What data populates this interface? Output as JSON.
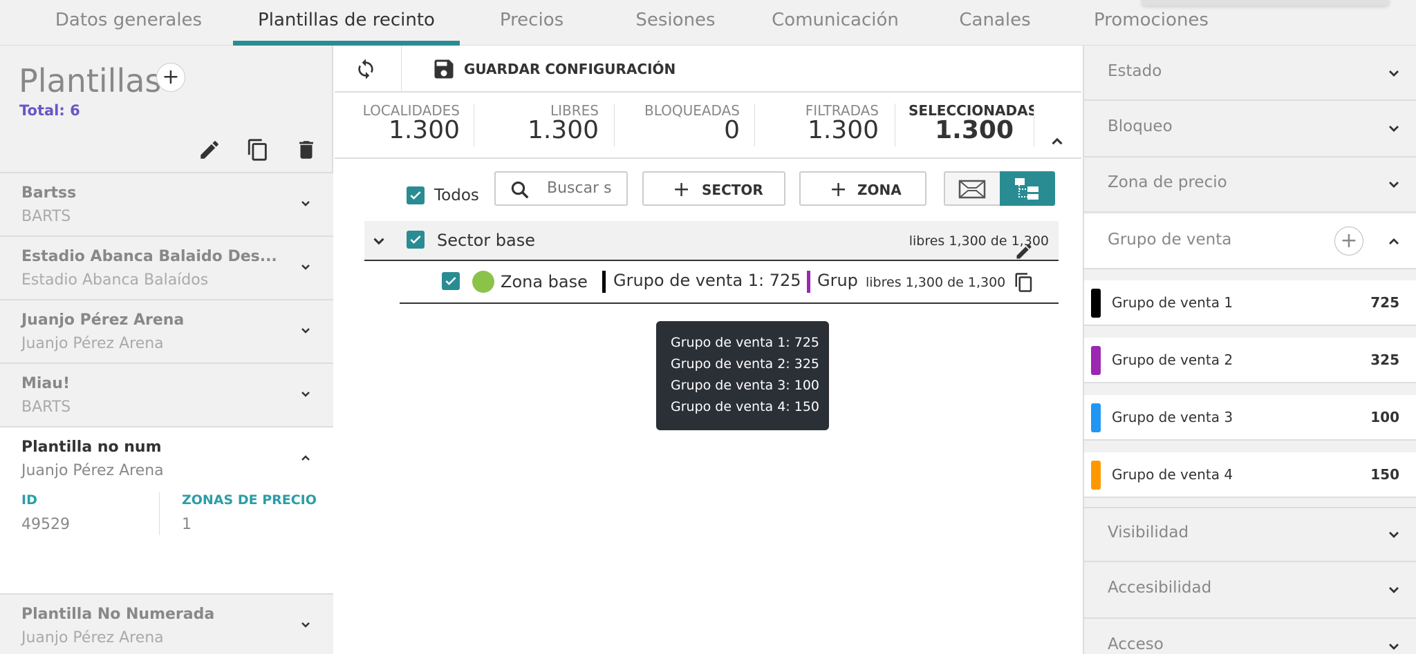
{
  "tabs": [
    {
      "label": "Datos generales"
    },
    {
      "label": "Plantillas de recinto"
    },
    {
      "label": "Precios"
    },
    {
      "label": "Sesiones"
    },
    {
      "label": "Comunicación"
    },
    {
      "label": "Canales"
    },
    {
      "label": "Promociones"
    }
  ],
  "left": {
    "title": "Plantillas",
    "total": "Total: 6",
    "templates": [
      {
        "name": "Bartss",
        "venue": "BARTS"
      },
      {
        "name": "Estadio Abanca Balaido Des...",
        "venue": "Estadio Abanca Balaídos"
      },
      {
        "name": "Juanjo Pérez Arena",
        "venue": "Juanjo Pérez Arena"
      },
      {
        "name": "Miau!",
        "venue": "BARTS"
      },
      {
        "name": "Plantilla no num",
        "venue": "Juanjo Pérez Arena",
        "id_label": "ID",
        "id_value": "49529",
        "zones_label": "ZONAS DE PRECIO",
        "zones_value": "1"
      },
      {
        "name": "Plantilla No Numerada",
        "venue": "Juanjo Pérez Arena"
      }
    ]
  },
  "toolbar": {
    "save_label": "GUARDAR CONFIGURACIÓN"
  },
  "stats": [
    {
      "label": "LOCALIDADES",
      "value": "1.300"
    },
    {
      "label": "LIBRES",
      "value": "1.300"
    },
    {
      "label": "BLOQUEADAS",
      "value": "0"
    },
    {
      "label": "FILTRADAS",
      "value": "1.300"
    },
    {
      "label": "SELECCIONADAS",
      "value": "1.300"
    }
  ],
  "controls": {
    "all_label": "Todos",
    "search_placeholder": "Buscar s",
    "add_sector_label": "SECTOR",
    "add_zone_label": "ZONA"
  },
  "sector": {
    "name": "Sector base",
    "free": "libres 1,300 de 1,300"
  },
  "zone": {
    "name": "Zona base",
    "group1": "Grupo de venta 1: 725",
    "group2_truncated": "Grup",
    "free": "libres 1,300 de 1,300"
  },
  "tooltip": {
    "lines": [
      "Grupo de venta 1: 725",
      "Grupo de venta 2: 325",
      "Grupo de venta 3: 100",
      "Grupo de venta 4: 150"
    ]
  },
  "right": {
    "filters_top": [
      {
        "label": "Estado"
      },
      {
        "label": "Bloqueo"
      },
      {
        "label": "Zona de precio"
      }
    ],
    "sales_group_title": "Grupo de venta",
    "groups": [
      {
        "name": "Grupo de venta 1",
        "count": "725",
        "color": "#000000"
      },
      {
        "name": "Grupo de venta 2",
        "count": "325",
        "color": "#9c27b0"
      },
      {
        "name": "Grupo de venta 3",
        "count": "100",
        "color": "#2196f3"
      },
      {
        "name": "Grupo de venta 4",
        "count": "150",
        "color": "#ff9800"
      }
    ],
    "filters_bottom": [
      {
        "label": "Visibilidad"
      },
      {
        "label": "Accesibilidad"
      },
      {
        "label": "Acceso"
      }
    ]
  },
  "colors": {
    "accent": "#2a8c93",
    "total": "#6a55c6",
    "zone_dot": "#8bc34a"
  }
}
